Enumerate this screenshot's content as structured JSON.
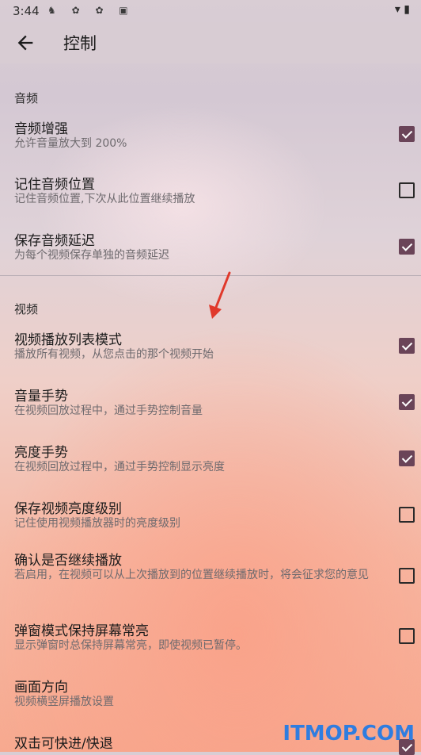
{
  "status_bar": {
    "time": "3:44",
    "left_icons": "♞ ✿ ✿ ▣",
    "right_icons": "▾ ▮"
  },
  "app_bar": {
    "title": "控制",
    "back_icon": "arrow-left-icon"
  },
  "sections": [
    {
      "header": "音频",
      "items": [
        {
          "title": "音频增强",
          "subtitle": "允许音量放大到 200%",
          "checked": true
        },
        {
          "title": "记住音频位置",
          "subtitle": "记住音频位置,下次从此位置继续播放",
          "checked": false
        },
        {
          "title": "保存音频延迟",
          "subtitle": "为每个视频保存单独的音频延迟",
          "checked": true
        }
      ]
    },
    {
      "header": "视频",
      "items": [
        {
          "title": "视频播放列表模式",
          "subtitle": "播放所有视频，从您点击的那个视频开始",
          "checked": true
        },
        {
          "title": "音量手势",
          "subtitle": "在视频回放过程中，通过手势控制音量",
          "checked": true
        },
        {
          "title": "亮度手势",
          "subtitle": "在视频回放过程中，通过手势控制显示亮度",
          "checked": true
        },
        {
          "title": "保存视频亮度级别",
          "subtitle": "记住使用视频播放器时的亮度级别",
          "checked": false
        },
        {
          "title": "确认是否继续播放",
          "subtitle": "若启用，在视频可以从上次播放到的位置继续播放时，将会征求您的意见",
          "checked": false
        },
        {
          "title": "弹窗模式保持屏幕常亮",
          "subtitle": "显示弹窗时总保持屏幕常亮，即使视频已暂停。",
          "checked": false
        },
        {
          "title": "画面方向",
          "subtitle": "视频横竖屏播放设置"
        },
        {
          "title": "双击可快进/快退",
          "subtitle": "",
          "checked": true
        }
      ]
    }
  ],
  "watermark": "ITMOP.COM",
  "colors": {
    "accent": "#6a4458",
    "arrow": "#e0392b",
    "watermark": "#2f7de0"
  }
}
